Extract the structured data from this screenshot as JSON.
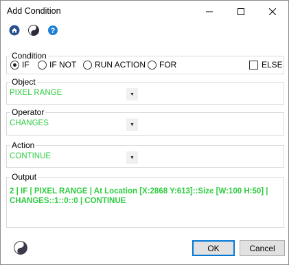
{
  "window": {
    "title": "Add Condition"
  },
  "toolbar": {
    "icons": [
      "home-icon",
      "yin-yang-icon",
      "help-icon"
    ]
  },
  "condition": {
    "label": "Condition",
    "options": [
      "IF",
      "IF NOT",
      "RUN ACTION",
      "FOR"
    ],
    "selected": "IF",
    "else_label": "ELSE",
    "else_checked": false
  },
  "object": {
    "label": "Object",
    "value": "PIXEL RANGE"
  },
  "operator": {
    "label": "Operator",
    "value": "CHANGES"
  },
  "action": {
    "label": "Action",
    "value": "CONTINUE"
  },
  "output": {
    "label": "Output",
    "text": "2 | IF | PIXEL RANGE | At Location [X:2868 Y:613]::Size [W:100 H:50] | CHANGES::1::0::0 | CONTINUE"
  },
  "buttons": {
    "ok": "OK",
    "cancel": "Cancel"
  },
  "colors": {
    "value_text": "#2ecc40",
    "accent": "#0078d7"
  }
}
